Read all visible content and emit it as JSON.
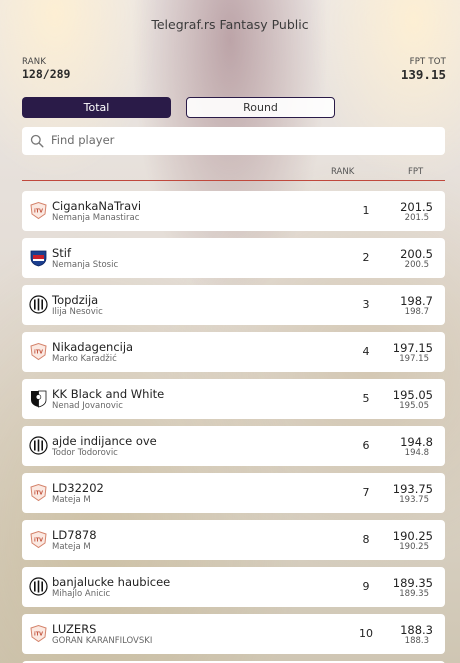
{
  "header": {
    "title": "Telegraf.rs Fantasy Public",
    "rank_label": "RANK",
    "rank_value": "128/289",
    "fpt_label": "FPT TOT",
    "fpt_value": "139.15"
  },
  "tabs": [
    {
      "label": "Total",
      "active": true
    },
    {
      "label": "Round",
      "active": false
    }
  ],
  "search": {
    "placeholder": "Find player",
    "value": ""
  },
  "columns": {
    "rank": "RANK",
    "fpt": "FPT"
  },
  "colors": {
    "accent": "#2a1b48",
    "divider": "#c0483c",
    "row_bg": "#ffffff"
  },
  "rows": [
    {
      "team": "CigankaNaTravi",
      "manager": "Nemanja Manastirac",
      "rank": "1",
      "fpt": "201.5",
      "fpt_sub": "201.5",
      "logo": "itv-icon"
    },
    {
      "team": "Stif",
      "manager": "Nemanja Stosic",
      "rank": "2",
      "fpt": "200.5",
      "fpt_sub": "200.5",
      "logo": "club-crest-icon"
    },
    {
      "team": "Topdzija",
      "manager": "Ilija Nesovic",
      "rank": "3",
      "fpt": "198.7",
      "fpt_sub": "198.7",
      "logo": "striped-shield-icon"
    },
    {
      "team": "Nikadagencija",
      "manager": "Marko Karadžić",
      "rank": "4",
      "fpt": "197.15",
      "fpt_sub": "197.15",
      "logo": "itv-icon"
    },
    {
      "team": "KK Black and White",
      "manager": "Nenad Jovanovic",
      "rank": "5",
      "fpt": "195.05",
      "fpt_sub": "195.05",
      "logo": "black-white-shield-icon"
    },
    {
      "team": "ajde indijance ove",
      "manager": "Todor Todorovic",
      "rank": "6",
      "fpt": "194.8",
      "fpt_sub": "194.8",
      "logo": "striped-shield-icon"
    },
    {
      "team": "LD32202",
      "manager": "Mateja M",
      "rank": "7",
      "fpt": "193.75",
      "fpt_sub": "193.75",
      "logo": "itv-icon"
    },
    {
      "team": "LD7878",
      "manager": "Mateja M",
      "rank": "8",
      "fpt": "190.25",
      "fpt_sub": "190.25",
      "logo": "itv-icon"
    },
    {
      "team": "banjalucke haubicee",
      "manager": "Mihajlo Anicic",
      "rank": "9",
      "fpt": "189.35",
      "fpt_sub": "189.35",
      "logo": "striped-shield-icon"
    },
    {
      "team": "LUZERS",
      "manager": "GORAN KARANFILOVSKI",
      "rank": "10",
      "fpt": "188.3",
      "fpt_sub": "188.3",
      "logo": "itv-icon"
    }
  ]
}
